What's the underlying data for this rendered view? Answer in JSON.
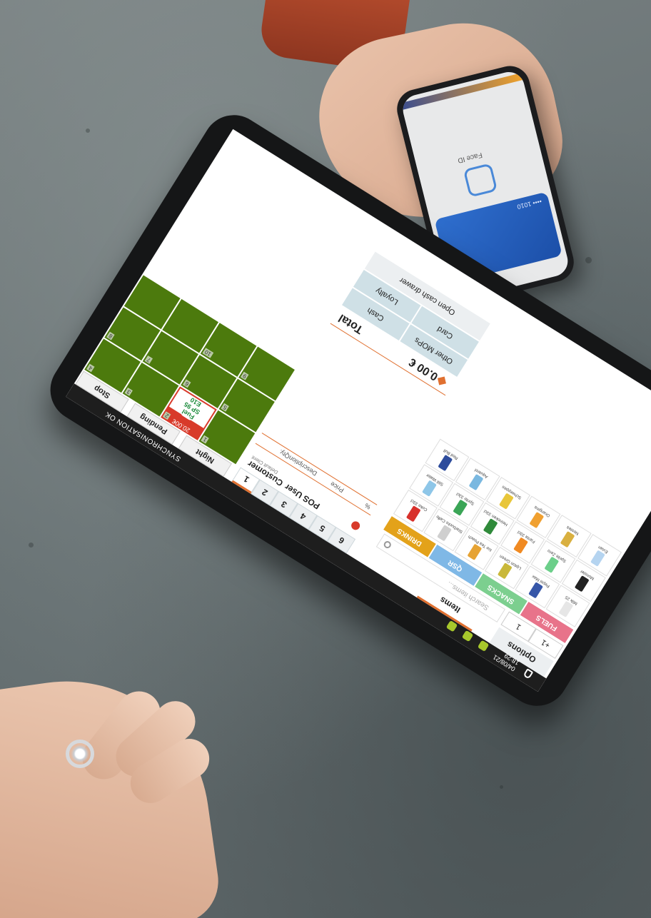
{
  "status_bar": {
    "sync_label": "SYNCHRONISATION OK",
    "date": "04/08/21",
    "time": "18:29"
  },
  "fast_tiles": {
    "tabs": [
      "Stop",
      "Pending",
      "Night"
    ],
    "promo": {
      "price": "20.00€",
      "code_line1": "SP 95",
      "code_line2": "E10",
      "label": "Fuel"
    },
    "numbers": [
      "1",
      "2",
      "3",
      "4",
      "5",
      "6",
      "7",
      "8",
      "9",
      "10"
    ],
    "tile_color": "#4c7a0d",
    "promo_color": "#d83a2a"
  },
  "ticket": {
    "tabs": [
      "1",
      "2",
      "3",
      "4",
      "5",
      "6"
    ],
    "pos_user": "POS User",
    "customer": "Customer",
    "customer_sub": "Default Client",
    "columns": {
      "qty": "Qty.",
      "description": "Description",
      "price": "Price",
      "percent": "%"
    },
    "total_label": "Total",
    "total_value": "0.00 €",
    "mops": {
      "cash": "Cash",
      "loyalty": "Loyalty",
      "card": "Card",
      "other": "Other MOPs",
      "open_drawer": "Open cash drawer"
    },
    "accent": "#e07030"
  },
  "items": {
    "options_label": "Options",
    "title": "Items",
    "search_placeholder": "Search items...",
    "qty_value": "1",
    "qty_plus": "+1",
    "categories": [
      {
        "label": "DRINKS",
        "color": "#e3a21a"
      },
      {
        "label": "QSR",
        "color": "#7fb8e6"
      },
      {
        "label": "SNACKS",
        "color": "#7ccf8f"
      },
      {
        "label": "FUELS",
        "color": "#e8738a"
      }
    ],
    "products": [
      {
        "label": "Coke 33cl",
        "color": "#d8312c"
      },
      {
        "label": "Starbucks Caffe",
        "color": "#cfcfcf"
      },
      {
        "label": "Ice Tea Peach",
        "color": "#e6a334"
      },
      {
        "label": "Lipton Green",
        "color": "#c9b83a"
      },
      {
        "label": "Pepsi Max",
        "color": "#3656a8"
      },
      {
        "label": "Milk 25",
        "color": "#e6e6e6"
      },
      {
        "label": "Still Water",
        "color": "#8ec6e8"
      },
      {
        "label": "Sprite 33cl",
        "color": "#3aa556"
      },
      {
        "label": "Heineken 33cl",
        "color": "#2f8a3a"
      },
      {
        "label": "Fanta 33cl",
        "color": "#f08a22"
      },
      {
        "label": "Sprite Zero",
        "color": "#6ccf8a"
      },
      {
        "label": "Monster",
        "color": "#222222"
      },
      {
        "label": "Red Bull",
        "color": "#2d4c9c"
      },
      {
        "label": "Aquarel",
        "color": "#7ab8e0"
      },
      {
        "label": "Schweppes",
        "color": "#e8c63a"
      },
      {
        "label": "Orangina",
        "color": "#f0a030"
      },
      {
        "label": "Nestea",
        "color": "#d9b040"
      },
      {
        "label": "Evian",
        "color": "#b5d4f0"
      }
    ]
  }
}
